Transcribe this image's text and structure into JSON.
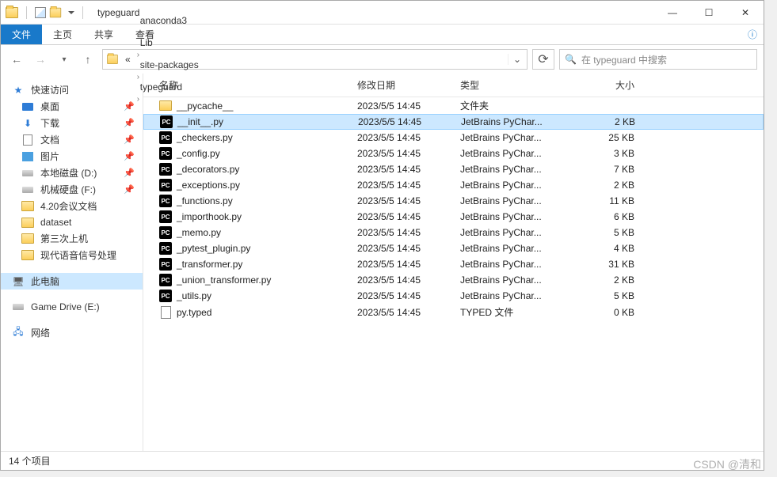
{
  "window": {
    "title": "typeguard"
  },
  "ribbon": {
    "file": "文件",
    "home": "主页",
    "share": "共享",
    "view": "查看"
  },
  "breadcrumb": {
    "prefix": "«",
    "items": [
      "anaconda3",
      "Lib",
      "site-packages",
      "typeguard"
    ]
  },
  "search": {
    "placeholder": "在 typeguard 中搜索"
  },
  "sidebar": {
    "quick": "快速访问",
    "desktop": "桌面",
    "downloads": "下载",
    "documents": "文档",
    "pictures": "图片",
    "drive_d": "本地磁盘 (D:)",
    "drive_f": "机械硬盘 (F:)",
    "folder1": "4.20会议文档",
    "folder2": "dataset",
    "folder3": "第三次上机",
    "folder4": "现代语音信号处理",
    "thispc": "此电脑",
    "gamedrive": "Game Drive (E:)",
    "network": "网络"
  },
  "columns": {
    "name": "名称",
    "date": "修改日期",
    "type": "类型",
    "size": "大小"
  },
  "files": [
    {
      "icon": "folder",
      "name": "__pycache__",
      "date": "2023/5/5 14:45",
      "type": "文件夹",
      "size": ""
    },
    {
      "icon": "pc",
      "name": "__init__.py",
      "date": "2023/5/5 14:45",
      "type": "JetBrains PyChar...",
      "size": "2 KB",
      "selected": true
    },
    {
      "icon": "pc",
      "name": "_checkers.py",
      "date": "2023/5/5 14:45",
      "type": "JetBrains PyChar...",
      "size": "25 KB"
    },
    {
      "icon": "pc",
      "name": "_config.py",
      "date": "2023/5/5 14:45",
      "type": "JetBrains PyChar...",
      "size": "3 KB"
    },
    {
      "icon": "pc",
      "name": "_decorators.py",
      "date": "2023/5/5 14:45",
      "type": "JetBrains PyChar...",
      "size": "7 KB"
    },
    {
      "icon": "pc",
      "name": "_exceptions.py",
      "date": "2023/5/5 14:45",
      "type": "JetBrains PyChar...",
      "size": "2 KB"
    },
    {
      "icon": "pc",
      "name": "_functions.py",
      "date": "2023/5/5 14:45",
      "type": "JetBrains PyChar...",
      "size": "11 KB"
    },
    {
      "icon": "pc",
      "name": "_importhook.py",
      "date": "2023/5/5 14:45",
      "type": "JetBrains PyChar...",
      "size": "6 KB"
    },
    {
      "icon": "pc",
      "name": "_memo.py",
      "date": "2023/5/5 14:45",
      "type": "JetBrains PyChar...",
      "size": "5 KB"
    },
    {
      "icon": "pc",
      "name": "_pytest_plugin.py",
      "date": "2023/5/5 14:45",
      "type": "JetBrains PyChar...",
      "size": "4 KB"
    },
    {
      "icon": "pc",
      "name": "_transformer.py",
      "date": "2023/5/5 14:45",
      "type": "JetBrains PyChar...",
      "size": "31 KB"
    },
    {
      "icon": "pc",
      "name": "_union_transformer.py",
      "date": "2023/5/5 14:45",
      "type": "JetBrains PyChar...",
      "size": "2 KB"
    },
    {
      "icon": "pc",
      "name": "_utils.py",
      "date": "2023/5/5 14:45",
      "type": "JetBrains PyChar...",
      "size": "5 KB"
    },
    {
      "icon": "txt",
      "name": "py.typed",
      "date": "2023/5/5 14:45",
      "type": "TYPED 文件",
      "size": "0 KB"
    }
  ],
  "status": {
    "count": "14 个项目"
  },
  "watermark": "CSDN @清和  "
}
